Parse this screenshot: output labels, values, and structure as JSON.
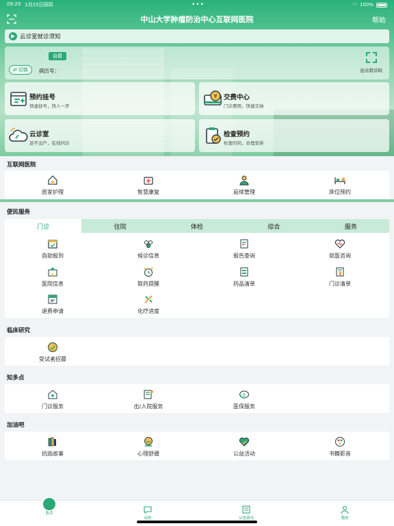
{
  "status": {
    "time": "09:29",
    "date": "1月25日周四",
    "battery": "100%"
  },
  "nav": {
    "title": "中山大学肿瘤防治中心互联网医院",
    "help": "帮助"
  },
  "notice": {
    "text": "云诊室就诊须知"
  },
  "id_card": {
    "badge": "自费",
    "switch_label": "切换",
    "record_label": "病历号：",
    "qr_label": "出示就诊码"
  },
  "services": [
    {
      "title": "预约挂号",
      "sub": "快速挂号，快人一步",
      "icon": "calendar-add-icon"
    },
    {
      "title": "交费中心",
      "sub": "门诊费用，快速交纳",
      "icon": "payment-icon"
    },
    {
      "title": "云诊室",
      "sub": "足不出户，在线问诊",
      "icon": "cloud-stethoscope-icon"
    },
    {
      "title": "检查预约",
      "sub": "检查时间，合理安排",
      "icon": "clipboard-check-icon"
    }
  ],
  "internet_hospital": {
    "title": "互联网医院",
    "items": [
      {
        "label": "居家护理",
        "icon": "home-care-icon"
      },
      {
        "label": "智慧康复",
        "icon": "medkit-icon"
      },
      {
        "label": "延续管理",
        "icon": "doctor-icon"
      },
      {
        "label": "床位预约",
        "icon": "bed-icon"
      }
    ]
  },
  "convenience": {
    "title": "便民服务",
    "tabs": [
      "门诊",
      "住院",
      "体检",
      "综合",
      "服务"
    ],
    "items": [
      {
        "label": "自助报到",
        "icon": "checkin-icon"
      },
      {
        "label": "候诊信息",
        "icon": "queue-icon"
      },
      {
        "label": "报告查询",
        "icon": "report-icon"
      },
      {
        "label": "就医咨询",
        "icon": "heart-consult-icon"
      },
      {
        "label": "医院信息",
        "icon": "hospital-icon"
      },
      {
        "label": "取药提醒",
        "icon": "alarm-icon"
      },
      {
        "label": "药品清单",
        "icon": "drug-list-icon"
      },
      {
        "label": "门诊清单",
        "icon": "bill-icon"
      },
      {
        "label": "退费申请",
        "icon": "refund-icon"
      },
      {
        "label": "化疗进度",
        "icon": "chemo-icon"
      }
    ]
  },
  "clinical": {
    "title": "临床研究",
    "items": [
      {
        "label": "受试者招募",
        "icon": "recruit-icon"
      }
    ]
  },
  "knowledge": {
    "title": "知多点",
    "items": [
      {
        "label": "门诊服务",
        "icon": "clinic-icon"
      },
      {
        "label": "出/入院服务",
        "icon": "admission-icon"
      },
      {
        "label": "医保服务",
        "icon": "insurance-icon"
      }
    ]
  },
  "cheer": {
    "title": "加油吧",
    "items": [
      {
        "label": "抗癌故事",
        "icon": "books-icon"
      },
      {
        "label": "心理舒缓",
        "icon": "mind-icon"
      },
      {
        "label": "公益活动",
        "icon": "charity-icon"
      },
      {
        "label": "书籍影音",
        "icon": "media-icon"
      }
    ]
  },
  "tabbar": [
    {
      "label": "首页",
      "icon": "home-icon"
    },
    {
      "label": "动态",
      "icon": "chat-icon"
    },
    {
      "label": "公告资讯",
      "icon": "news-icon"
    },
    {
      "label": "我的",
      "icon": "user-icon"
    }
  ],
  "colors": {
    "primary": "#2aa876",
    "tab_bg": "#c7ebd6"
  }
}
